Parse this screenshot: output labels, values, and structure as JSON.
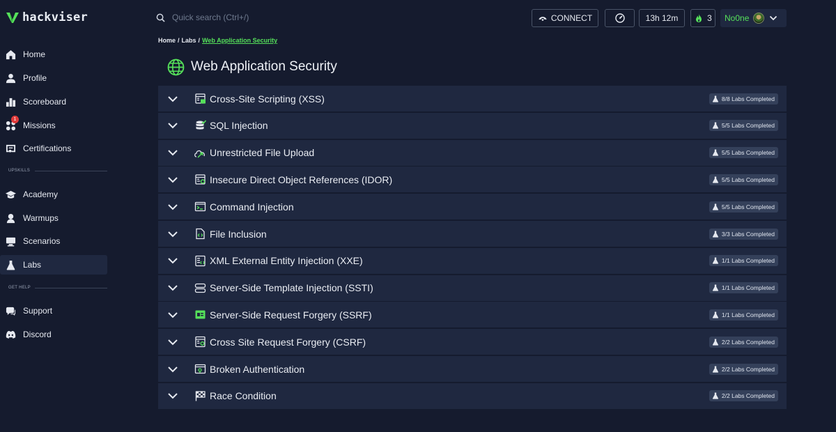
{
  "brand": {
    "name": "hackviser",
    "accent": "#55e05a"
  },
  "search": {
    "placeholder": "Quick search (Ctrl+/)"
  },
  "topbar": {
    "connect_label": "CONNECT",
    "timer": "13h 12m",
    "streak": "3",
    "username": "No0ne"
  },
  "sidebar": {
    "main_items": [
      {
        "label": "Home",
        "icon": "home-icon"
      },
      {
        "label": "Profile",
        "icon": "user-icon"
      },
      {
        "label": "Scoreboard",
        "icon": "bar-chart-icon"
      },
      {
        "label": "Missions",
        "icon": "missions-icon",
        "badge": "1"
      },
      {
        "label": "Certifications",
        "icon": "certificate-icon"
      }
    ],
    "upskills_label": "UPSKILLS",
    "upskills_items": [
      {
        "label": "Academy",
        "icon": "graduation-cap-icon"
      },
      {
        "label": "Warmups",
        "icon": "warmups-icon"
      },
      {
        "label": "Scenarios",
        "icon": "scenarios-icon"
      },
      {
        "label": "Labs",
        "icon": "flask-icon",
        "active": true
      }
    ],
    "help_label": "GET HELP",
    "help_items": [
      {
        "label": "Support",
        "icon": "support-icon"
      },
      {
        "label": "Discord",
        "icon": "discord-icon"
      }
    ]
  },
  "breadcrumb": {
    "home": "Home",
    "sep": "/",
    "labs": "Labs",
    "current": "Web Application Security"
  },
  "page": {
    "title": "Web Application Security",
    "icon": "globe-icon"
  },
  "categories": [
    {
      "label": "Cross-Site Scripting (XSS)",
      "status": "8/8 Labs Completed",
      "icon": "xss-icon"
    },
    {
      "label": "SQL Injection",
      "status": "5/5 Labs Completed",
      "icon": "database-icon"
    },
    {
      "label": "Unrestricted File Upload",
      "status": "5/5 Labs Completed",
      "icon": "upload-icon"
    },
    {
      "label": "Insecure Direct Object References (IDOR)",
      "status": "5/5 Labs Completed",
      "icon": "idor-icon"
    },
    {
      "label": "Command Injection",
      "status": "5/5 Labs Completed",
      "icon": "terminal-icon"
    },
    {
      "label": "File Inclusion",
      "status": "3/3 Labs Completed",
      "icon": "file-code-icon"
    },
    {
      "label": "XML External Entity Injection (XXE)",
      "status": "1/1 Labs Completed",
      "icon": "xml-icon"
    },
    {
      "label": "Server-Side Template Injection (SSTI)",
      "status": "1/1 Labs Completed",
      "icon": "server-icon"
    },
    {
      "label": "Server-Side Request Forgery (SSRF)",
      "status": "1/1 Labs Completed",
      "icon": "ssrf-icon"
    },
    {
      "label": "Cross Site Request Forgery (CSRF)",
      "status": "2/2 Labs Completed",
      "icon": "csrf-icon"
    },
    {
      "label": "Broken Authentication",
      "status": "2/2 Labs Completed",
      "icon": "broken-auth-icon"
    },
    {
      "label": "Race Condition",
      "status": "2/2 Labs Completed",
      "icon": "race-flag-icon"
    }
  ]
}
